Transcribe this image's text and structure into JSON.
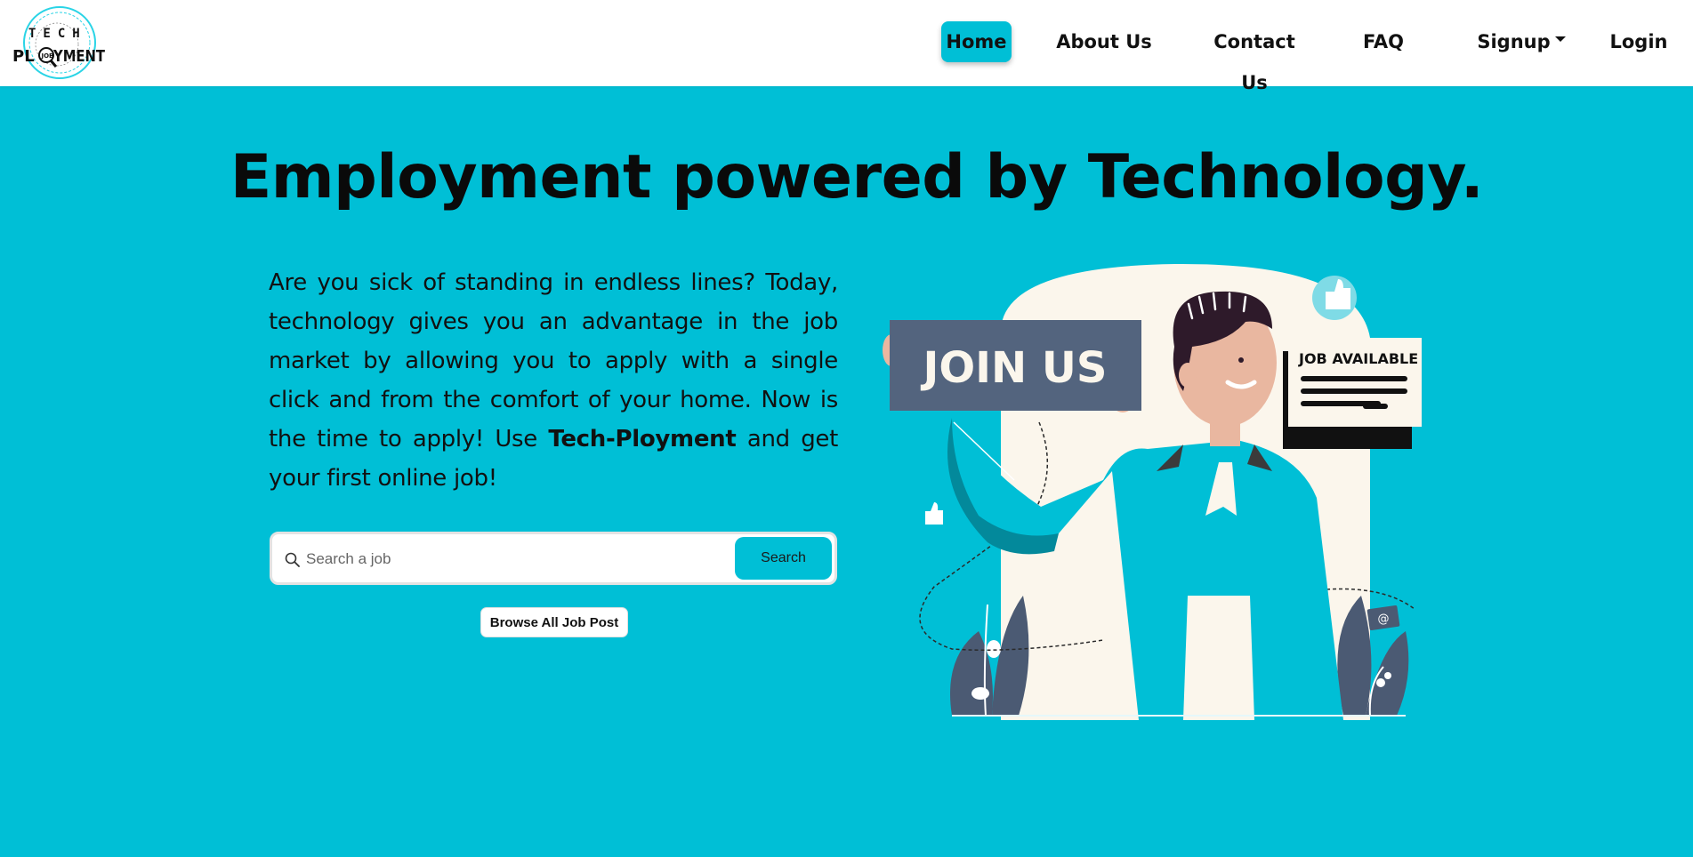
{
  "brand": {
    "logo_top": "TECH",
    "logo_bottom_left": "PL",
    "logo_bottom_right": "YMENT",
    "logo_badge": "JOB"
  },
  "nav": {
    "home": "Home",
    "about": "About Us",
    "contact": "Contact Us",
    "faq": "FAQ",
    "signup": "Signup",
    "login": "Login",
    "active": "home",
    "accent_color": "#00bfd6"
  },
  "hero": {
    "headline": "Employment powered by Technology.",
    "intro_part1": "Are you sick of standing in endless lines? Today, technology gives you an advantage in the job market by allowing you to apply with a single click and from the comfort of your home. Now is the time to apply! Use ",
    "intro_brand": "Tech-Ployment",
    "intro_part2": " and get your first online job!",
    "background_color": "#00bfd6"
  },
  "search": {
    "placeholder": "Search a job",
    "value": "",
    "button_label": "Search",
    "icon": "search-icon"
  },
  "browse": {
    "button_label": "Browse All Job Post"
  },
  "illustration": {
    "sign_text": "JOIN US",
    "card_title": "JOB AVAILABLE",
    "at_symbol": "@"
  }
}
